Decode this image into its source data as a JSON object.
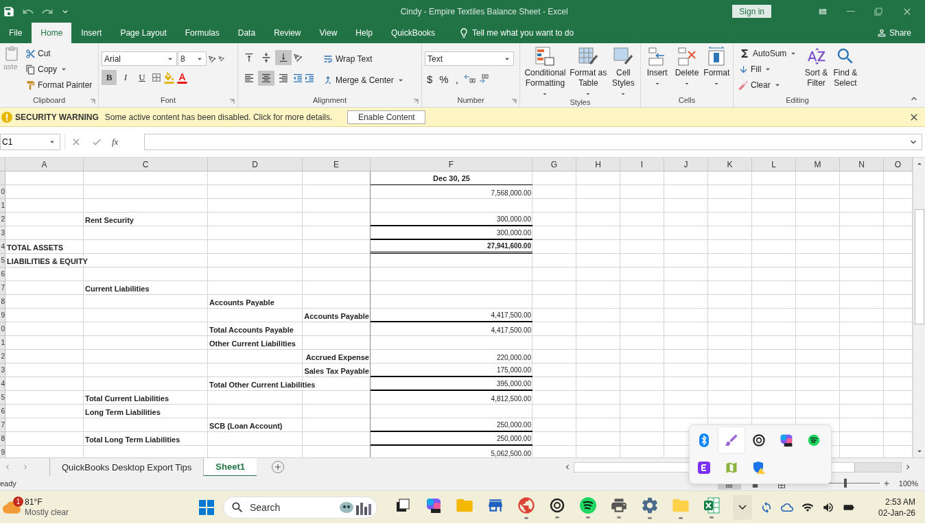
{
  "window": {
    "title": "Cindy - Empire Textiles Balance Sheet  -  Excel",
    "sign_in": "Sign in"
  },
  "tabs": [
    {
      "label": "File",
      "selected": false
    },
    {
      "label": "Home",
      "selected": true
    },
    {
      "label": "Insert",
      "selected": false
    },
    {
      "label": "Page Layout",
      "selected": false
    },
    {
      "label": "Formulas",
      "selected": false
    },
    {
      "label": "Data",
      "selected": false
    },
    {
      "label": "Review",
      "selected": false
    },
    {
      "label": "View",
      "selected": false
    },
    {
      "label": "Help",
      "selected": false
    },
    {
      "label": "QuickBooks",
      "selected": false
    }
  ],
  "tell_me": "Tell me what you want to do",
  "share": "Share",
  "ribbon": {
    "clipboard": {
      "paste": "aste",
      "cut": "Cut",
      "copy": "Copy",
      "format_painter": "Format Painter",
      "label": "Clipboard"
    },
    "font": {
      "name": "Arial",
      "size": "8",
      "styles": [
        {
          "label": "B",
          "on": true
        },
        {
          "label": "I",
          "on": false
        },
        {
          "label": "U",
          "on": false
        }
      ],
      "label": "Font"
    },
    "alignment": {
      "vertical_align": [
        {
          "selected": false
        },
        {
          "selected": false
        },
        {
          "selected": true
        }
      ],
      "horizontal_align": [
        {
          "selected": false
        },
        {
          "selected": true
        },
        {
          "selected": false
        }
      ],
      "wrap_text": "Wrap Text",
      "merge": "Merge & Center",
      "label": "Alignment"
    },
    "number": {
      "format": "Text",
      "symbols": [
        "$",
        "%",
        ","
      ],
      "label": "Number"
    },
    "styles": {
      "buttons": [
        "Conditional Formatting",
        "Format as Table",
        "Cell Styles"
      ],
      "label": "Styles"
    },
    "cells": {
      "buttons": [
        "Insert",
        "Delete",
        "Format"
      ],
      "label": "Cells"
    },
    "editing": {
      "autosum": "AutoSum",
      "fill": "Fill",
      "clear": "Clear",
      "sort": "Sort & Filter",
      "find": "Find & Select",
      "label": "Editing"
    }
  },
  "security": {
    "title": "SECURITY WARNING",
    "message": "Some active content has been disabled. Click for more details.",
    "button": "Enable Content"
  },
  "formula_bar": {
    "name_box": "C1",
    "fx": "fx"
  },
  "columns": [
    "A",
    "C",
    "D",
    "E",
    "F",
    "G",
    "H",
    "I",
    "J",
    "K",
    "L",
    "M",
    "N",
    "O"
  ],
  "rows": [
    {
      "kind": "heading",
      "f": "Dec 30, 25",
      "f_bold": true,
      "ruled": true,
      "double": false
    },
    {
      "kind": "line",
      "header": "0",
      "f": "7,568,000.00",
      "f_bold": false,
      "ruled": false
    },
    {
      "kind": "line",
      "header": "1",
      "ruled": false
    },
    {
      "kind": "line",
      "header": "2",
      "c": "Rent Security",
      "f": "300,000.00",
      "f_bold": false,
      "ruled": true,
      "double": false
    },
    {
      "kind": "line",
      "header": "3",
      "f": "300,000.00",
      "f_bold": false,
      "ruled": true,
      "double": false
    },
    {
      "kind": "line",
      "header": "4",
      "a": "TOTAL ASSETS",
      "f": "27,941,600.00",
      "f_bold": true,
      "ruled": true,
      "double": true
    },
    {
      "kind": "line",
      "header": "5",
      "a": "LIABILITIES & EQUITY",
      "ruled": false
    },
    {
      "kind": "line",
      "header": "6",
      "ruled": false
    },
    {
      "kind": "line",
      "header": "7",
      "c": "Current Liabilities",
      "ruled": false
    },
    {
      "kind": "line",
      "header": "8",
      "d": "Accounts Payable",
      "ruled": false
    },
    {
      "kind": "line",
      "header": "9",
      "e": "Accounts Payable",
      "f": "4,417,500.00",
      "f_bold": false,
      "ruled": true,
      "double": false
    },
    {
      "kind": "line",
      "header": "0",
      "d": "Total Accounts Payable",
      "f": "4,417,500.00",
      "f_bold": false,
      "ruled": false
    },
    {
      "kind": "line",
      "header": "1",
      "d": "Other Current Liabilities",
      "ruled": false
    },
    {
      "kind": "line",
      "header": "2",
      "e": "Accrued Expense",
      "f": "220,000.00",
      "f_bold": false,
      "ruled": false
    },
    {
      "kind": "line",
      "header": "3",
      "e": "Sales Tax Payable",
      "f": "175,000.00",
      "f_bold": false,
      "ruled": true,
      "double": false
    },
    {
      "kind": "line",
      "header": "4",
      "d": "Total Other Current Liabilities",
      "f": "395,000.00",
      "f_bold": false,
      "ruled": true,
      "double": false
    },
    {
      "kind": "line",
      "header": "5",
      "c": "Total Current Liabilities",
      "f": "4,812,500.00",
      "f_bold": false,
      "ruled": false
    },
    {
      "kind": "line",
      "header": "6",
      "c": "Long Term Liabilities",
      "ruled": false
    },
    {
      "kind": "line",
      "header": "7",
      "d": "SCB (Loan Account)",
      "f": "250,000.00",
      "f_bold": false,
      "ruled": true,
      "double": false
    },
    {
      "kind": "line",
      "header": "8",
      "c": "Total Long Term Liabilities",
      "f": "250,000.00",
      "f_bold": false,
      "ruled": true,
      "double": false
    },
    {
      "kind": "line",
      "header": "9",
      "f": "5,062,500.00",
      "f_bold": false,
      "ruled": false
    }
  ],
  "sheet_tabs": [
    {
      "label": "QuickBooks Desktop Export Tips",
      "selected": false
    },
    {
      "label": "Sheet1",
      "selected": true
    }
  ],
  "status": {
    "text": "eady",
    "zoom": "100%",
    "slider": {
      "level": 0.5
    }
  },
  "tray_popup": [
    {
      "kind": "bluetooth",
      "highlighted": false
    },
    {
      "kind": "quill",
      "highlighted": true
    },
    {
      "kind": "knot",
      "highlighted": false
    },
    {
      "kind": "copilot",
      "highlighted": false
    },
    {
      "kind": "music",
      "highlighted": false
    },
    {
      "kind": "tile",
      "highlighted": false
    },
    {
      "kind": "map",
      "highlighted": false
    },
    {
      "kind": "shield",
      "highlighted": false
    }
  ],
  "taskbar": {
    "weather": {
      "badge": "1",
      "temp": "81°F",
      "desc": "Mostly clear"
    },
    "search": "Search",
    "apps": [
      {
        "kind": "tasks",
        "running": false
      },
      {
        "kind": "copilot",
        "running": false
      },
      {
        "kind": "folder",
        "running": false
      },
      {
        "kind": "store",
        "running": false
      },
      {
        "kind": "browser",
        "running": true
      },
      {
        "kind": "knot",
        "running": true
      },
      {
        "kind": "music",
        "running": true
      },
      {
        "kind": "device",
        "running": true
      },
      {
        "kind": "gear",
        "running": true
      },
      {
        "kind": "files",
        "running": true
      },
      {
        "kind": "sheet",
        "running": true
      }
    ],
    "time": "2:53 AM",
    "date": "02-Jan-26"
  }
}
